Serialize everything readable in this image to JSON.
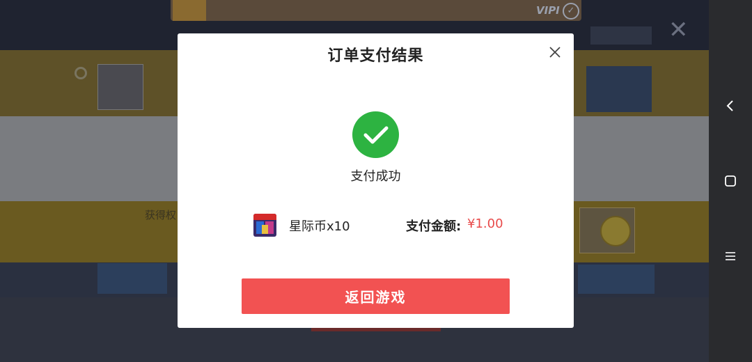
{
  "background": {
    "vip_label": "VIPI",
    "gold_section_label": "获得权"
  },
  "modal": {
    "title": "订单支付结果",
    "status_text": "支付成功",
    "product": {
      "name": "星际币x10",
      "icon": "marvel-game-icon"
    },
    "amount_label": "支付金额:",
    "amount_value": "¥1.00",
    "return_button_label": "返回游戏"
  },
  "nav": {
    "back_icon": "chevron-left-icon",
    "home_icon": "square-icon",
    "menu_icon": "hamburger-icon"
  },
  "colors": {
    "success": "#2db341",
    "button": "#f25252",
    "price": "#e84a4a"
  }
}
